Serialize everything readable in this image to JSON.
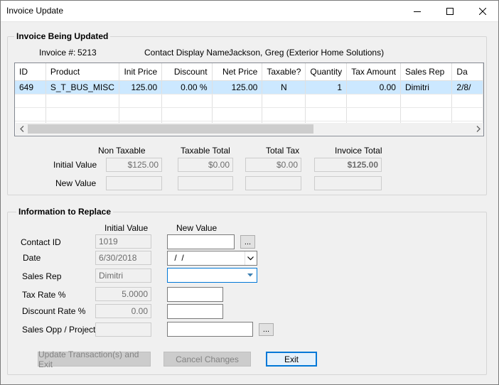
{
  "window": {
    "title": "Invoice Update"
  },
  "invoice_group": {
    "title": "Invoice Being Updated",
    "invoice_label": "Invoice #:",
    "invoice_number": "5213",
    "contact_label": "Contact Display Name:",
    "contact_name": "Jackson, Greg (Exterior Home Solutions)"
  },
  "grid": {
    "columns": [
      "ID",
      "Product",
      "Init Price",
      "Discount",
      "Net Price",
      "Taxable?",
      "Quantity",
      "Tax Amount",
      "Sales Rep",
      "Da"
    ],
    "rows": [
      [
        "649",
        "S_T_BUS_MISC",
        "125.00",
        "0.00 %",
        "125.00",
        "N",
        "1",
        "0.00",
        "Dimitri",
        "2/8/"
      ]
    ]
  },
  "totals": {
    "headers": [
      "Non Taxable",
      "Taxable Total",
      "Total Tax",
      "Invoice Total"
    ],
    "initial_label": "Initial Value",
    "new_label": "New Value",
    "initial_values": [
      "$125.00",
      "$0.00",
      "$0.00",
      "$125.00"
    ],
    "new_values": [
      "",
      "",
      "",
      ""
    ]
  },
  "replace_group": {
    "title": "Information to Replace",
    "initial_header": "Initial Value",
    "new_header": "New Value",
    "fields": {
      "contact_id": {
        "label": "Contact ID",
        "initial": "1019",
        "new": ""
      },
      "date": {
        "label": "Date",
        "initial": "6/30/2018",
        "new": " /  /"
      },
      "sales_rep": {
        "label": "Sales Rep",
        "initial": "Dimitri",
        "new": ""
      },
      "tax_rate": {
        "label": "Tax Rate %",
        "initial": "5.0000",
        "new": ""
      },
      "discount_rate": {
        "label": "Discount Rate %",
        "initial": "0.00",
        "new": ""
      },
      "sales_opp": {
        "label": "Sales Opp / Project",
        "initial": "",
        "new": ""
      }
    },
    "browse_label": "..."
  },
  "buttons": {
    "update": "Update Transaction(s) and Exit",
    "cancel": "Cancel Changes",
    "exit": "Exit"
  },
  "colors": {
    "selected_row": "#cce8ff",
    "focus_border": "#0078d7"
  }
}
